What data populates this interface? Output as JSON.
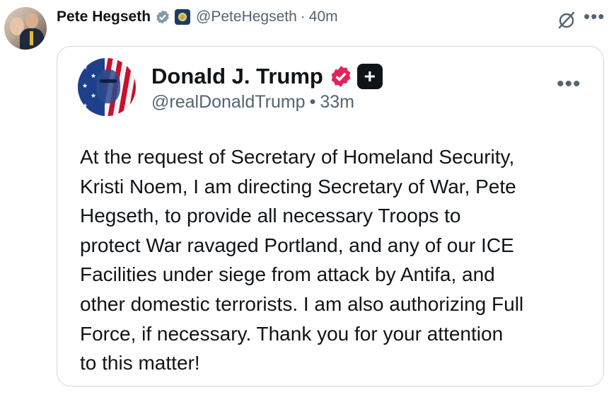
{
  "post": {
    "author_name": "Pete Hegseth",
    "author_handle": "@PeteHegseth",
    "separator": "·",
    "time": "40m",
    "more_label": "•••"
  },
  "quoted_post": {
    "author_name": "Donald J. Trump",
    "author_handle": "@realDonaldTrump",
    "separator": "•",
    "time": "33m",
    "badge_plus": "+",
    "more_label": "•••",
    "text": "At the request of Secretary of Homeland Security,\nKristi Noem, I am directing Secretary of War, Pete\nHegseth, to provide all necessary Troops to\nprotect War ravaged Portland, and any of our ICE\nFacilities under siege from attack by Antifa, and\nother domestic terrorists. I am also authorizing Full\nForce, if necessary. Thank you for your attention\nto this matter!"
  },
  "icons": {
    "outer_verified": "verified-badge-gray",
    "affiliation": "government-seal-badge",
    "grok": "grok-icon",
    "inner_verified": "verified-badge-red",
    "more": "more-icon"
  },
  "colors": {
    "text_primary": "#0f1419",
    "text_secondary": "#536471",
    "border": "#cfd9de",
    "verified_red": "#e0245e",
    "verified_gray": "#829aab"
  }
}
